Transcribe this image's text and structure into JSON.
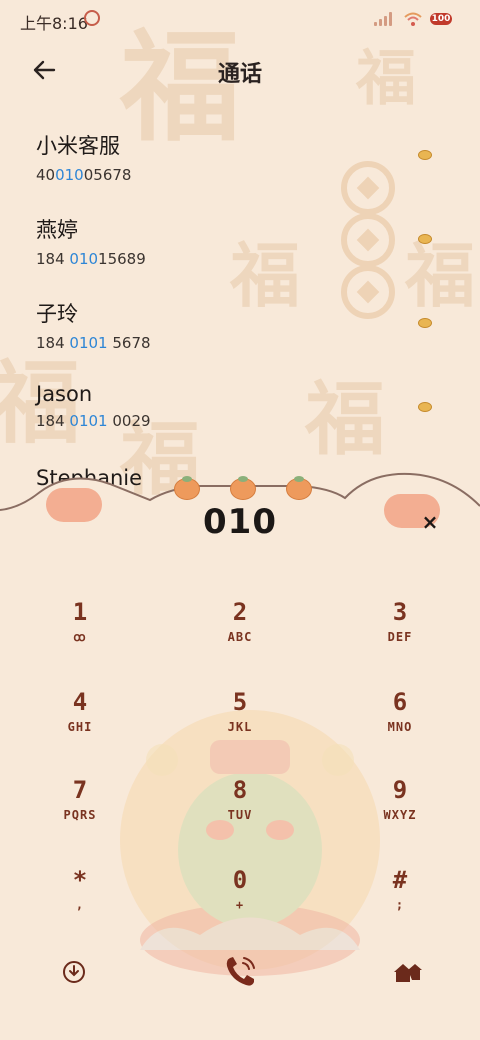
{
  "status": {
    "time": "上午8:16",
    "battery": "100"
  },
  "header": {
    "title": "通话"
  },
  "contacts": [
    {
      "name": "小米客服",
      "num_pre": "40",
      "num_hl": "010",
      "num_post": "05678"
    },
    {
      "name": "燕婷",
      "num_pre": "184 ",
      "num_hl": "010",
      "num_post": "15689"
    },
    {
      "name": "子玲",
      "num_pre": "184 ",
      "num_hl": "0101",
      "num_post": " 5678"
    },
    {
      "name": "Jason",
      "num_pre": "184 ",
      "num_hl": "0101",
      "num_post": " 0029"
    },
    {
      "name": "Stephanie",
      "num_pre": "",
      "num_hl": "",
      "num_post": ""
    }
  ],
  "dialer": {
    "input": "010",
    "clear": "×"
  },
  "keys": [
    {
      "num": "1",
      "letters": "ꝏ"
    },
    {
      "num": "2",
      "letters": "ABC"
    },
    {
      "num": "3",
      "letters": "DEF"
    },
    {
      "num": "4",
      "letters": "GHI"
    },
    {
      "num": "5",
      "letters": "JKL"
    },
    {
      "num": "6",
      "letters": "MNO"
    },
    {
      "num": "7",
      "letters": "PQRS"
    },
    {
      "num": "8",
      "letters": "TUV"
    },
    {
      "num": "9",
      "letters": "WXYZ"
    },
    {
      "num": "*",
      "letters": ","
    },
    {
      "num": "0",
      "letters": "+"
    },
    {
      "num": "#",
      "letters": ";"
    }
  ],
  "background_glyph": "福",
  "icons": {
    "back": "arrow-left-icon",
    "collapse": "download-circle-icon",
    "call": "phone-icon",
    "contacts": "house-icon",
    "clear": "close-icon"
  },
  "colors": {
    "background": "#f8e9d9",
    "accent": "#2e86d6",
    "key": "#7a3320"
  }
}
